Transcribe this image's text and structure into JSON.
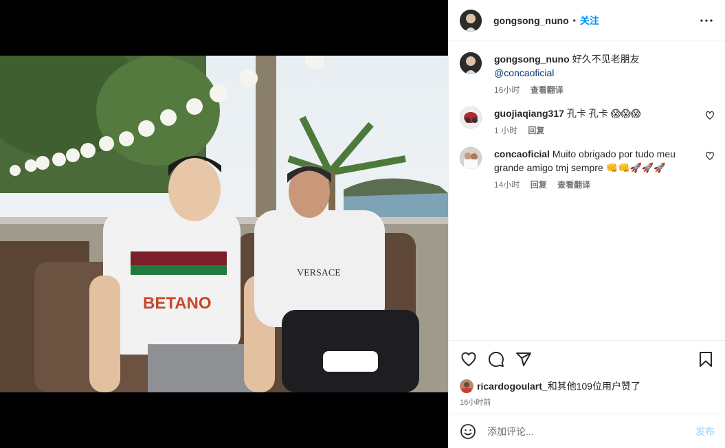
{
  "post": {
    "author": "gongsong_nuno",
    "follow_label": "关注",
    "dot": "•"
  },
  "caption": {
    "username": "gongsong_nuno",
    "text": "好久不见老朋友",
    "mention": "@concaoficial",
    "time": "16小时",
    "translate": "查看翻译"
  },
  "comments": [
    {
      "username": "guojiaqiang317",
      "text": "孔卡 孔卡 😱😱😱",
      "time": "1 小时",
      "reply": "回复"
    },
    {
      "username": "concaoficial",
      "text": "Muito obrigado por tudo meu grande amigo tmj sempre 👊👊🚀🚀🚀",
      "time": "14小时",
      "reply": "回复",
      "translate": "查看翻译"
    }
  ],
  "likes": {
    "user": "ricardogoulart_",
    "suffix": "和其他109位用户赞了"
  },
  "timestamp": "16小时前",
  "add_comment": {
    "placeholder": "添加评论...",
    "post_label": "发布"
  },
  "icons": {
    "more": "more-horizontal-icon",
    "heart": "heart-icon",
    "comment": "comment-icon",
    "share": "share-icon",
    "bookmark": "bookmark-icon",
    "emoji": "emoji-icon"
  },
  "colors": {
    "accent": "#0095f6",
    "mention": "#00376b",
    "secondary_text": "#737373",
    "post_disabled": "#b2dffc"
  }
}
